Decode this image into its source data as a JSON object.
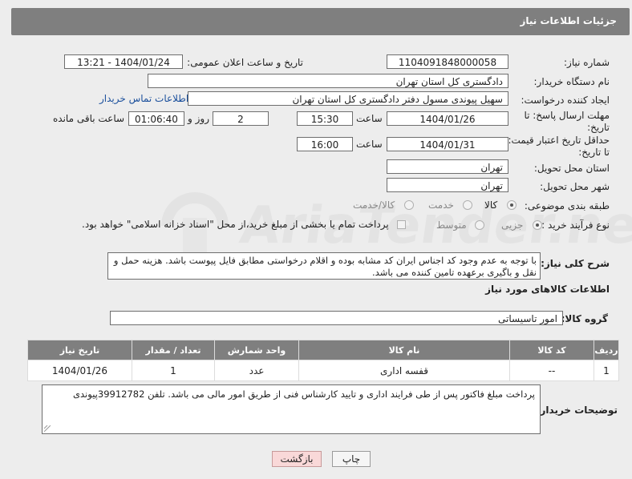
{
  "header": {
    "title": "جزئیات اطلاعات نیاز"
  },
  "watermark": {
    "text": "AriaTender.net"
  },
  "form": {
    "need_number_label": "شماره نیاز:",
    "need_number": "1104091848000058",
    "announce_label": "تاریخ و ساعت اعلان عمومی:",
    "announce_value": "1404/01/24 - 13:21",
    "buyer_org_label": "نام دستگاه خریدار:",
    "buyer_org": "دادگستری کل استان تهران",
    "creator_label": "ایجاد کننده درخواست:",
    "creator": "سهیل پیوندی مسول دفتر  دادگستری کل استان تهران",
    "contact_link": "اطلاعات تماس خریدار",
    "deadline_label_1": "مهلت ارسال پاسخ: تا",
    "deadline_label_2": "تاریخ:",
    "deadline_date": "1404/01/26",
    "time_label": "ساعت",
    "deadline_time": "15:30",
    "days_value": "2",
    "days_label": "روز و",
    "remaining_time": "01:06:40",
    "remaining_label": "ساعت باقی مانده",
    "min_price_label_1": "حداقل تاریخ اعتبار قیمت:",
    "min_price_label_2": "تا تاریخ:",
    "min_price_date": "1404/01/31",
    "min_price_time": "16:00",
    "province_label": "استان محل تحویل:",
    "province": "تهران",
    "city_label": "شهر محل تحویل:",
    "city": "تهران",
    "category_label": "طبقه بندی موضوعی:",
    "category_options": [
      "کالا",
      "خدمت",
      "کالا/خدمت"
    ],
    "process_label": "نوع فرآیند خرید :",
    "process_options": [
      "جزیی",
      "متوسط"
    ],
    "payment_note": "پرداخت تمام یا بخشی از مبلغ خرید،از محل \"اسناد خزانه اسلامی\" خواهد بود.",
    "description_label": "شرح کلی نیاز:",
    "description": "با توجه به عدم وجود کد اجناس ایران کد مشابه بوده و اقلام درخواستی مطابق فایل پیوست باشد. هزینه حمل و نقل و باگیری برعهده تامین کننده می باشد."
  },
  "goods": {
    "section_title": "اطلاعات کالاهای مورد نیاز",
    "group_label": "گروه کالا:",
    "group_value": "امور تاسیساتی",
    "columns": [
      "ردیف",
      "کد کالا",
      "نام کالا",
      "واحد شمارش",
      "تعداد / مقدار",
      "تاریخ نیاز"
    ],
    "rows": [
      {
        "row": "1",
        "code": "--",
        "name": "قفسه اداری",
        "unit": "عدد",
        "qty": "1",
        "date": "1404/01/26"
      }
    ]
  },
  "buyer_notes": {
    "label": "توضیحات خریدار:",
    "text": "پرداخت مبلغ فاکتور پس از طی فرایند اداری و تایید کارشناس فنی از طریق امور مالی می باشد. تلفن 39912782پیوندی"
  },
  "buttons": {
    "print": "چاپ",
    "back": "بازگشت"
  }
}
